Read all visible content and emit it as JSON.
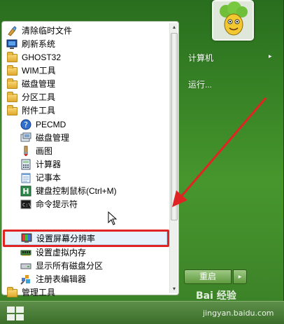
{
  "colors": {
    "accent_red": "#e02424",
    "highlight": "#e6f1fb",
    "menu_green": "#3f8a28"
  },
  "program_list": {
    "items": [
      {
        "label": "清除临时文件",
        "icon": "cleanup-icon"
      },
      {
        "label": "刷新系统",
        "icon": "refresh-system-icon"
      },
      {
        "label": "GHOST32",
        "icon": "folder-icon"
      },
      {
        "label": "WIM工具",
        "icon": "folder-icon"
      },
      {
        "label": "磁盘管理",
        "icon": "folder-icon"
      },
      {
        "label": "分区工具",
        "icon": "folder-icon"
      },
      {
        "label": "附件工具",
        "icon": "folder-icon"
      },
      {
        "label": "PECMD",
        "icon": "help-icon"
      },
      {
        "label": "磁盘管理",
        "icon": "disk-management-icon"
      },
      {
        "label": "画图",
        "icon": "paint-icon"
      },
      {
        "label": "计算器",
        "icon": "calculator-icon"
      },
      {
        "label": "记事本",
        "icon": "notepad-icon"
      },
      {
        "label": "键盘控制鼠标(Ctrl+M)",
        "icon": "keyboard-mouse-icon"
      },
      {
        "label": "命令提示符",
        "icon": "cmd-icon"
      },
      {
        "label": "设置屏幕分辨率",
        "icon": "display-icon"
      },
      {
        "label": "设置虚拟内存",
        "icon": "memory-icon"
      },
      {
        "label": "显示所有磁盘分区",
        "icon": "drive-icon"
      },
      {
        "label": "注册表编辑器",
        "icon": "regedit-icon"
      },
      {
        "label": "管理工具",
        "icon": "folder-icon"
      }
    ]
  },
  "right_pane": {
    "computer_label": "计算机",
    "run_label": "运行...",
    "restart_label": "重启",
    "restart_arrow": "▸",
    "computer_arrow": "▸"
  },
  "scrollbar": {
    "up": "▴",
    "down": "▾"
  },
  "watermark": {
    "brand": "Bai 经验",
    "url": "jingyan.baidu.com"
  }
}
